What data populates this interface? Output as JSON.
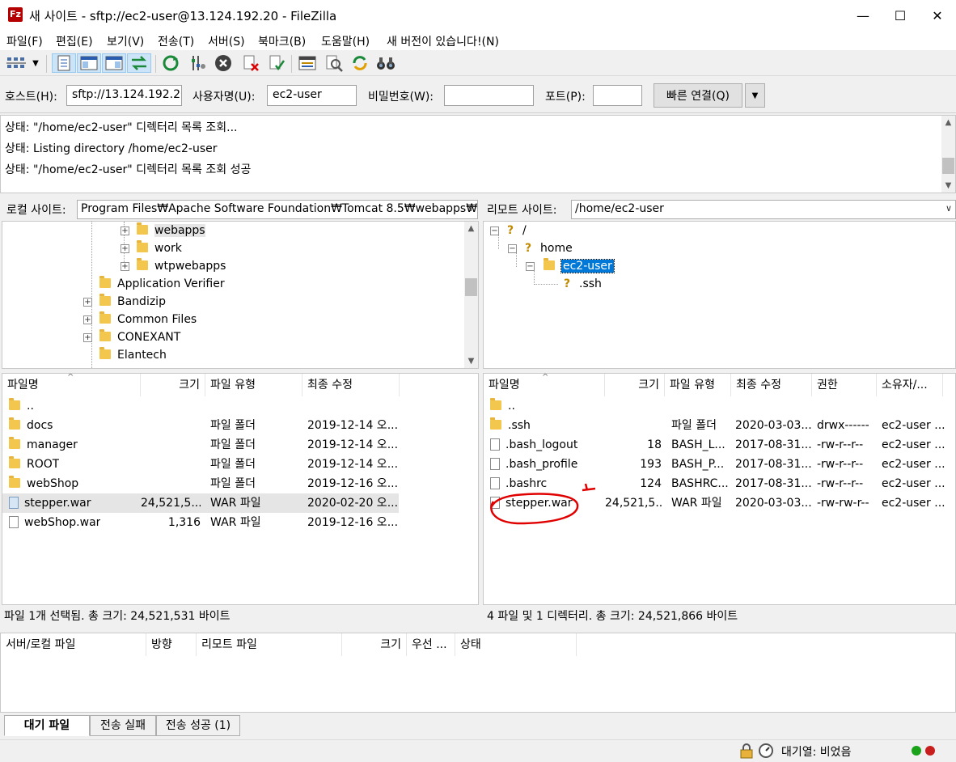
{
  "window": {
    "title": "새 사이트 - sftp://ec2-user@13.124.192.20 - FileZilla",
    "app_icon": "Fz",
    "controls": {
      "minimize": "—",
      "maximize": "☐",
      "close": "✕"
    }
  },
  "menu": [
    "파일(F)",
    "편집(E)",
    "보기(V)",
    "전송(T)",
    "서버(S)",
    "북마크(B)",
    "도움말(H)",
    "새 버전이 있습니다!(N)"
  ],
  "toolbar": {
    "icons": [
      "site-manager-icon",
      "dropdown-arrow-icon",
      "toggle-message-log-icon",
      "toggle-local-tree-icon",
      "toggle-remote-tree-icon",
      "toggle-queue-icon",
      "refresh-icon",
      "process-queue-icon",
      "cancel-icon",
      "disconnect-icon",
      "reconnect-icon",
      "filter-icon",
      "compare-icon",
      "sync-browse-icon",
      "find-icon"
    ]
  },
  "quickconnect": {
    "host_label": "호스트(H):",
    "host_value": "sftp://13.124.192.20",
    "user_label": "사용자명(U):",
    "user_value": "ec2-user",
    "pass_label": "비밀번호(W):",
    "pass_value": "",
    "port_label": "포트(P):",
    "port_value": "",
    "connect_label": "빠른 연결(Q)",
    "dropdown": "▼"
  },
  "log": [
    {
      "prefix": "상태:",
      "text": "\"/home/ec2-user\" 디렉터리 목록 조회..."
    },
    {
      "prefix": "상태:",
      "text": "Listing directory /home/ec2-user"
    },
    {
      "prefix": "상태:",
      "text": "\"/home/ec2-user\" 디렉터리 목록 조회 성공"
    }
  ],
  "local": {
    "site_label": "로컬 사이트:",
    "path": "Program Files₩Apache Software Foundation₩Tomcat 8.5₩webapps₩",
    "tree": [
      "webapps",
      "work",
      "wtpwebapps",
      "Application Verifier",
      "Bandizip",
      "Common Files",
      "CONEXANT",
      "Elantech"
    ],
    "columns": [
      "파일명",
      "크기",
      "파일 유형",
      "최종 수정"
    ],
    "files": [
      {
        "name": "..",
        "size": "",
        "type": "",
        "modified": ""
      },
      {
        "name": "docs",
        "size": "",
        "type": "파일 폴더",
        "modified": "2019-12-14 오..."
      },
      {
        "name": "manager",
        "size": "",
        "type": "파일 폴더",
        "modified": "2019-12-14 오..."
      },
      {
        "name": "ROOT",
        "size": "",
        "type": "파일 폴더",
        "modified": "2019-12-14 오..."
      },
      {
        "name": "webShop",
        "size": "",
        "type": "파일 폴더",
        "modified": "2019-12-16 오..."
      },
      {
        "name": "stepper.war",
        "size": "24,521,5...",
        "type": "WAR 파일",
        "modified": "2020-02-20 오..."
      },
      {
        "name": "webShop.war",
        "size": "1,316",
        "type": "WAR 파일",
        "modified": "2019-12-16 오..."
      }
    ],
    "status": "파일 1개 선택됨. 총 크기: 24,521,531 바이트"
  },
  "remote": {
    "site_label": "리모트 사이트:",
    "path": "/home/ec2-user",
    "tree": [
      "/",
      "home",
      "ec2-user",
      ".ssh"
    ],
    "columns": [
      "파일명",
      "크기",
      "파일 유형",
      "최종 수정",
      "권한",
      "소유자/..."
    ],
    "files": [
      {
        "name": "..",
        "size": "",
        "type": "",
        "modified": "",
        "perm": "",
        "owner": ""
      },
      {
        "name": ".ssh",
        "size": "",
        "type": "파일 폴더",
        "modified": "2020-03-03...",
        "perm": "drwx------",
        "owner": "ec2-user ..."
      },
      {
        "name": ".bash_logout",
        "size": "18",
        "type": "BASH_L...",
        "modified": "2017-08-31...",
        "perm": "-rw-r--r--",
        "owner": "ec2-user ..."
      },
      {
        "name": ".bash_profile",
        "size": "193",
        "type": "BASH_P...",
        "modified": "2017-08-31...",
        "perm": "-rw-r--r--",
        "owner": "ec2-user ..."
      },
      {
        "name": ".bashrc",
        "size": "124",
        "type": "BASHRC...",
        "modified": "2017-08-31...",
        "perm": "-rw-r--r--",
        "owner": "ec2-user ..."
      },
      {
        "name": "stepper.war",
        "size": "24,521,5...",
        "type": "WAR 파일",
        "modified": "2020-03-03...",
        "perm": "-rw-rw-r--",
        "owner": "ec2-user ..."
      }
    ],
    "status": "4 파일 및 1 디렉터리. 총 크기: 24,521,866 바이트"
  },
  "queue": {
    "columns": [
      "서버/로컬 파일",
      "방향",
      "리모트 파일",
      "크기",
      "우선 ...",
      "상태"
    ],
    "tabs": [
      "대기 파일",
      "전송 실패",
      "전송 성공 (1)"
    ]
  },
  "statusbar": {
    "queue_text": "대기열: 비었음"
  },
  "colors": {
    "selection": "#0078d7",
    "annotation_red": "#e00000",
    "led_green": "#1aa31a",
    "led_red": "#c81e1e"
  }
}
